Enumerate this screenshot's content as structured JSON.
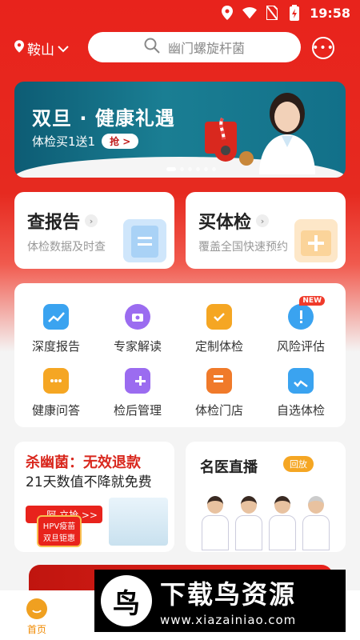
{
  "status": {
    "time": "19:58"
  },
  "top": {
    "city": "鞍山",
    "search_placeholder": "幽门螺旋杆菌"
  },
  "banner": {
    "title": "双旦 · 健康礼遇",
    "subtitle": "体检买1送1",
    "button": "抢 >"
  },
  "cards": [
    {
      "title": "查报告",
      "subtitle": "体检数据及时查"
    },
    {
      "title": "买体检",
      "subtitle": "覆盖全国快速预约"
    }
  ],
  "services": [
    {
      "label": "深度报告",
      "icon": "report-chart-icon",
      "color": "#3aa3f0"
    },
    {
      "label": "专家解读",
      "icon": "phone-expert-icon",
      "color": "#9b6cf0"
    },
    {
      "label": "定制体检",
      "icon": "custom-box-icon",
      "color": "#f5a623"
    },
    {
      "label": "风险评估",
      "icon": "shield-alert-icon",
      "color": "#3aa3f0",
      "badge": "NEW"
    },
    {
      "label": "健康问答",
      "icon": "chat-bubble-icon",
      "color": "#f5a623"
    },
    {
      "label": "检后管理",
      "icon": "manage-plus-icon",
      "color": "#9b6cf0"
    },
    {
      "label": "体检门店",
      "icon": "store-doc-icon",
      "color": "#f07a2a"
    },
    {
      "label": "自选体检",
      "icon": "calendar-check-icon",
      "color": "#3aa3f0"
    }
  ],
  "promo": {
    "headline": "杀幽菌：无效退款",
    "sub": "21天数值不降就免费",
    "button": "阿  立抢 >>",
    "badge1": "HPV疫苗",
    "badge2": "双旦钜惠"
  },
  "live": {
    "title": "名医直播",
    "replay": "回放"
  },
  "tabbar": {
    "home": "首页"
  },
  "watermark": {
    "title": "下载鸟资源",
    "url": "www.xiazainiao.com"
  },
  "colors": {
    "brand_red": "#e8231c",
    "accent_orange": "#f5a623"
  }
}
